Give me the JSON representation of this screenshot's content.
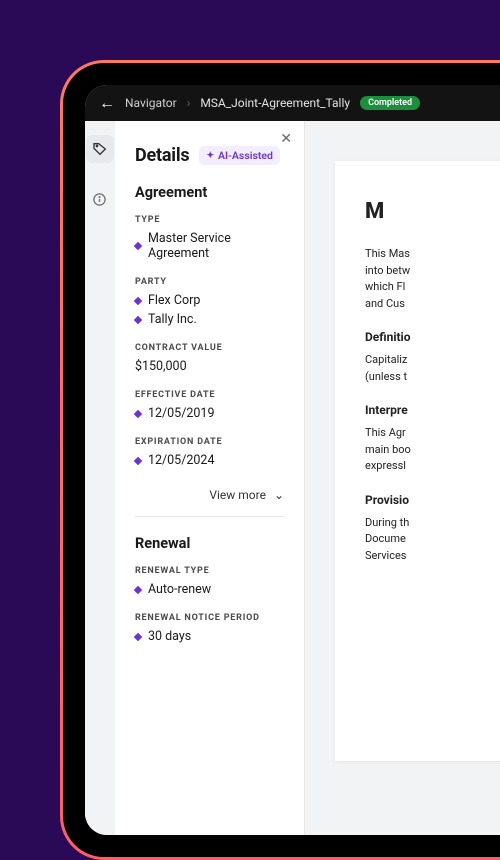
{
  "topbar": {
    "navigator_label": "Navigator",
    "filename": "MSA_Joint-Agreement_Tally",
    "status": "Completed"
  },
  "panel": {
    "title": "Details",
    "ai_chip": "AI-Assisted",
    "view_more": "View more"
  },
  "agreement": {
    "heading": "Agreement",
    "type_label": "TYPE",
    "type_value": "Master Service Agreement",
    "party_label": "PARTY",
    "party_values": [
      "Flex Corp",
      "Tally Inc."
    ],
    "contract_value_label": "CONTRACT VALUE",
    "contract_value": "$150,000",
    "effective_date_label": "EFFECTIVE DATE",
    "effective_date": "12/05/2019",
    "expiration_date_label": "EXPIRATION DATE",
    "expiration_date": "12/05/2024"
  },
  "renewal": {
    "heading": "Renewal",
    "renewal_type_label": "RENEWAL TYPE",
    "renewal_type": "Auto-renew",
    "renewal_notice_label": "RENEWAL NOTICE PERIOD",
    "renewal_notice": "30 days"
  },
  "document": {
    "heading_visible": "M",
    "intro": "This Mas\ninto betw\nwhich Fl\nand Cus",
    "definitions_heading": "Definitio",
    "definitions_body": "Capitaliz\n(unless t",
    "interpretation_heading": "Interpre",
    "interpretation_body": "This Agr\nmain boo\nexpressl",
    "provisions_heading": "Provisio",
    "provisions_body": "During th\nDocume\nServices"
  }
}
